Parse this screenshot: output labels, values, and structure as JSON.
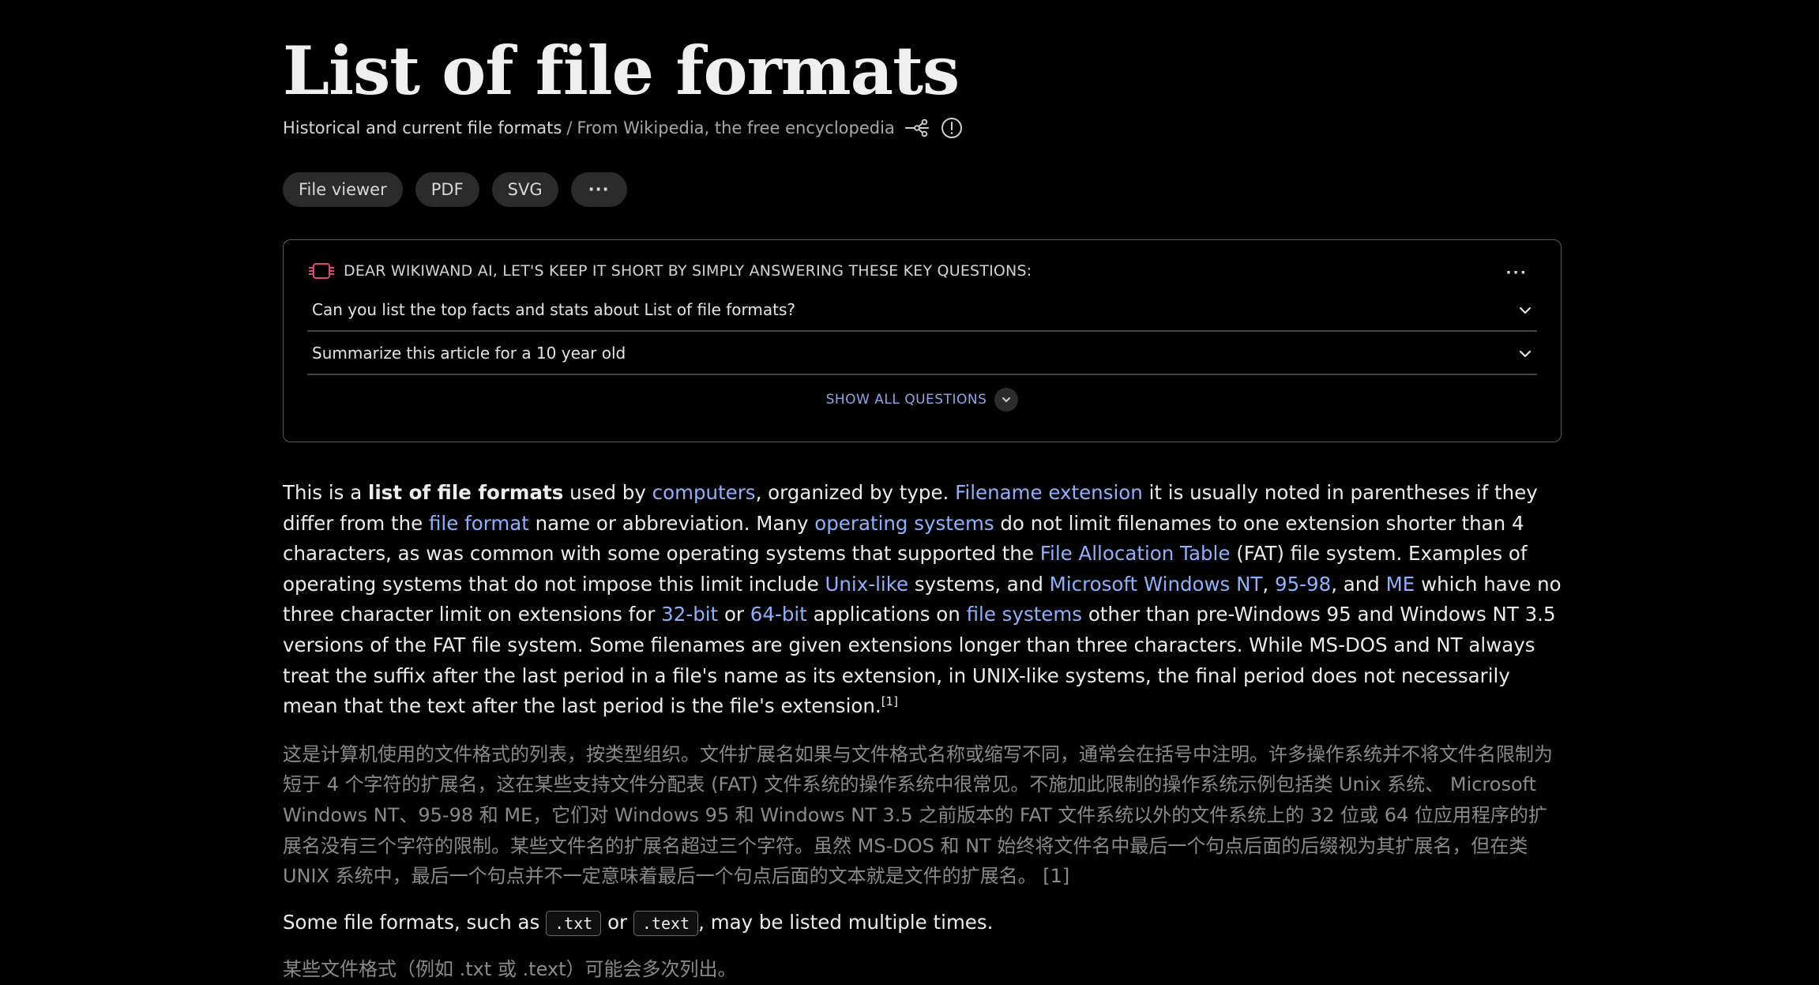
{
  "title": "List of file formats",
  "subtitle": {
    "description": "Historical and current file formats",
    "separator": "/",
    "source": "From Wikipedia, the free encyclopedia",
    "icons": [
      "connections-icon",
      "info-icon"
    ]
  },
  "chips": [
    {
      "label": "File viewer"
    },
    {
      "label": "PDF"
    },
    {
      "label": "SVG"
    },
    {
      "label": "···"
    }
  ],
  "ai_box": {
    "heading": "DEAR WIKIWAND AI, LET'S KEEP IT SHORT BY SIMPLY ANSWERING THESE KEY QUESTIONS:",
    "menu": "···",
    "questions": [
      {
        "text": "Can you list the top facts and stats about List of file formats?"
      },
      {
        "text": "Summarize this article for a 10 year old"
      }
    ],
    "show_all": "SHOW ALL QUESTIONS",
    "accent_color": "#e0457b",
    "link_color": "#8da6e8"
  },
  "intro": {
    "t1": "This is a ",
    "bold": "list of file formats",
    "t2": " used by ",
    "l_computers": "computers",
    "t3": ", organized by type. ",
    "l_filename_ext": "Filename extension",
    "t4": " it is usually noted in parentheses if they differ from the ",
    "l_file_format": "file format",
    "t5": " name or abbreviation. Many ",
    "l_os": "operating systems",
    "t6": " do not limit filenames to one extension shorter than 4 characters, as was common with some operating systems that supported the ",
    "l_fat": "File Allocation Table",
    "t7": " (FAT) file system. Examples of operating systems that do not impose this limit include ",
    "l_unix": "Unix-like",
    "t8": " systems, and ",
    "l_winnt": "Microsoft Windows NT",
    "t9": ", ",
    "l_9598": "95-98",
    "t10": ", and ",
    "l_me": "ME",
    "t11": " which have no three character limit on extensions for ",
    "l_32": "32-bit",
    "t12": " or ",
    "l_64": "64-bit",
    "t13": " applications on ",
    "l_fs": "file systems",
    "t14": " other than pre-Windows 95 and Windows NT 3.5 versions of the FAT file system. Some filenames are given extensions longer than three characters. While MS-DOS and NT always treat the suffix after the last period in a file's name as its extension, in UNIX-like systems, the final period does not necessarily mean that the text after the last period is the file's extension.",
    "ref": "[1]"
  },
  "intro_zh": "这是计算机使用的文件格式的列表，按类型组织。文件扩展名如果与文件格式名称或缩写不同，通常会在括号中注明。许多操作系统并不将文件名限制为短于 4 个字符的扩展名，这在某些支持文件分配表 (FAT) 文件系统的操作系统中很常见。不施加此限制的操作系统示例包括类 Unix 系统、 Microsoft Windows NT、95-98 和 ME，它们对 Windows 95 和 Windows NT 3.5 之前版本的 FAT 文件系统以外的文件系统上的 32 位或 64 位应用程序的扩展名没有三个字符的限制。某些文件名的扩展名超过三个字符。虽然 MS-DOS 和 NT 始终将文件名中最后一个句点后面的后缀视为其扩展名，但在类 UNIX 系统中，最后一个句点并不一定意味着最后一个句点后面的文本就是文件的扩展名。 [1]",
  "multi": {
    "t1": "Some file formats, such as ",
    "code1": ".txt",
    "t2": " or ",
    "code2": ".text",
    "t3": ", may be listed multiple times."
  },
  "multi_zh": "某些文件格式（例如 .txt 或 .text）可能会多次列出。"
}
